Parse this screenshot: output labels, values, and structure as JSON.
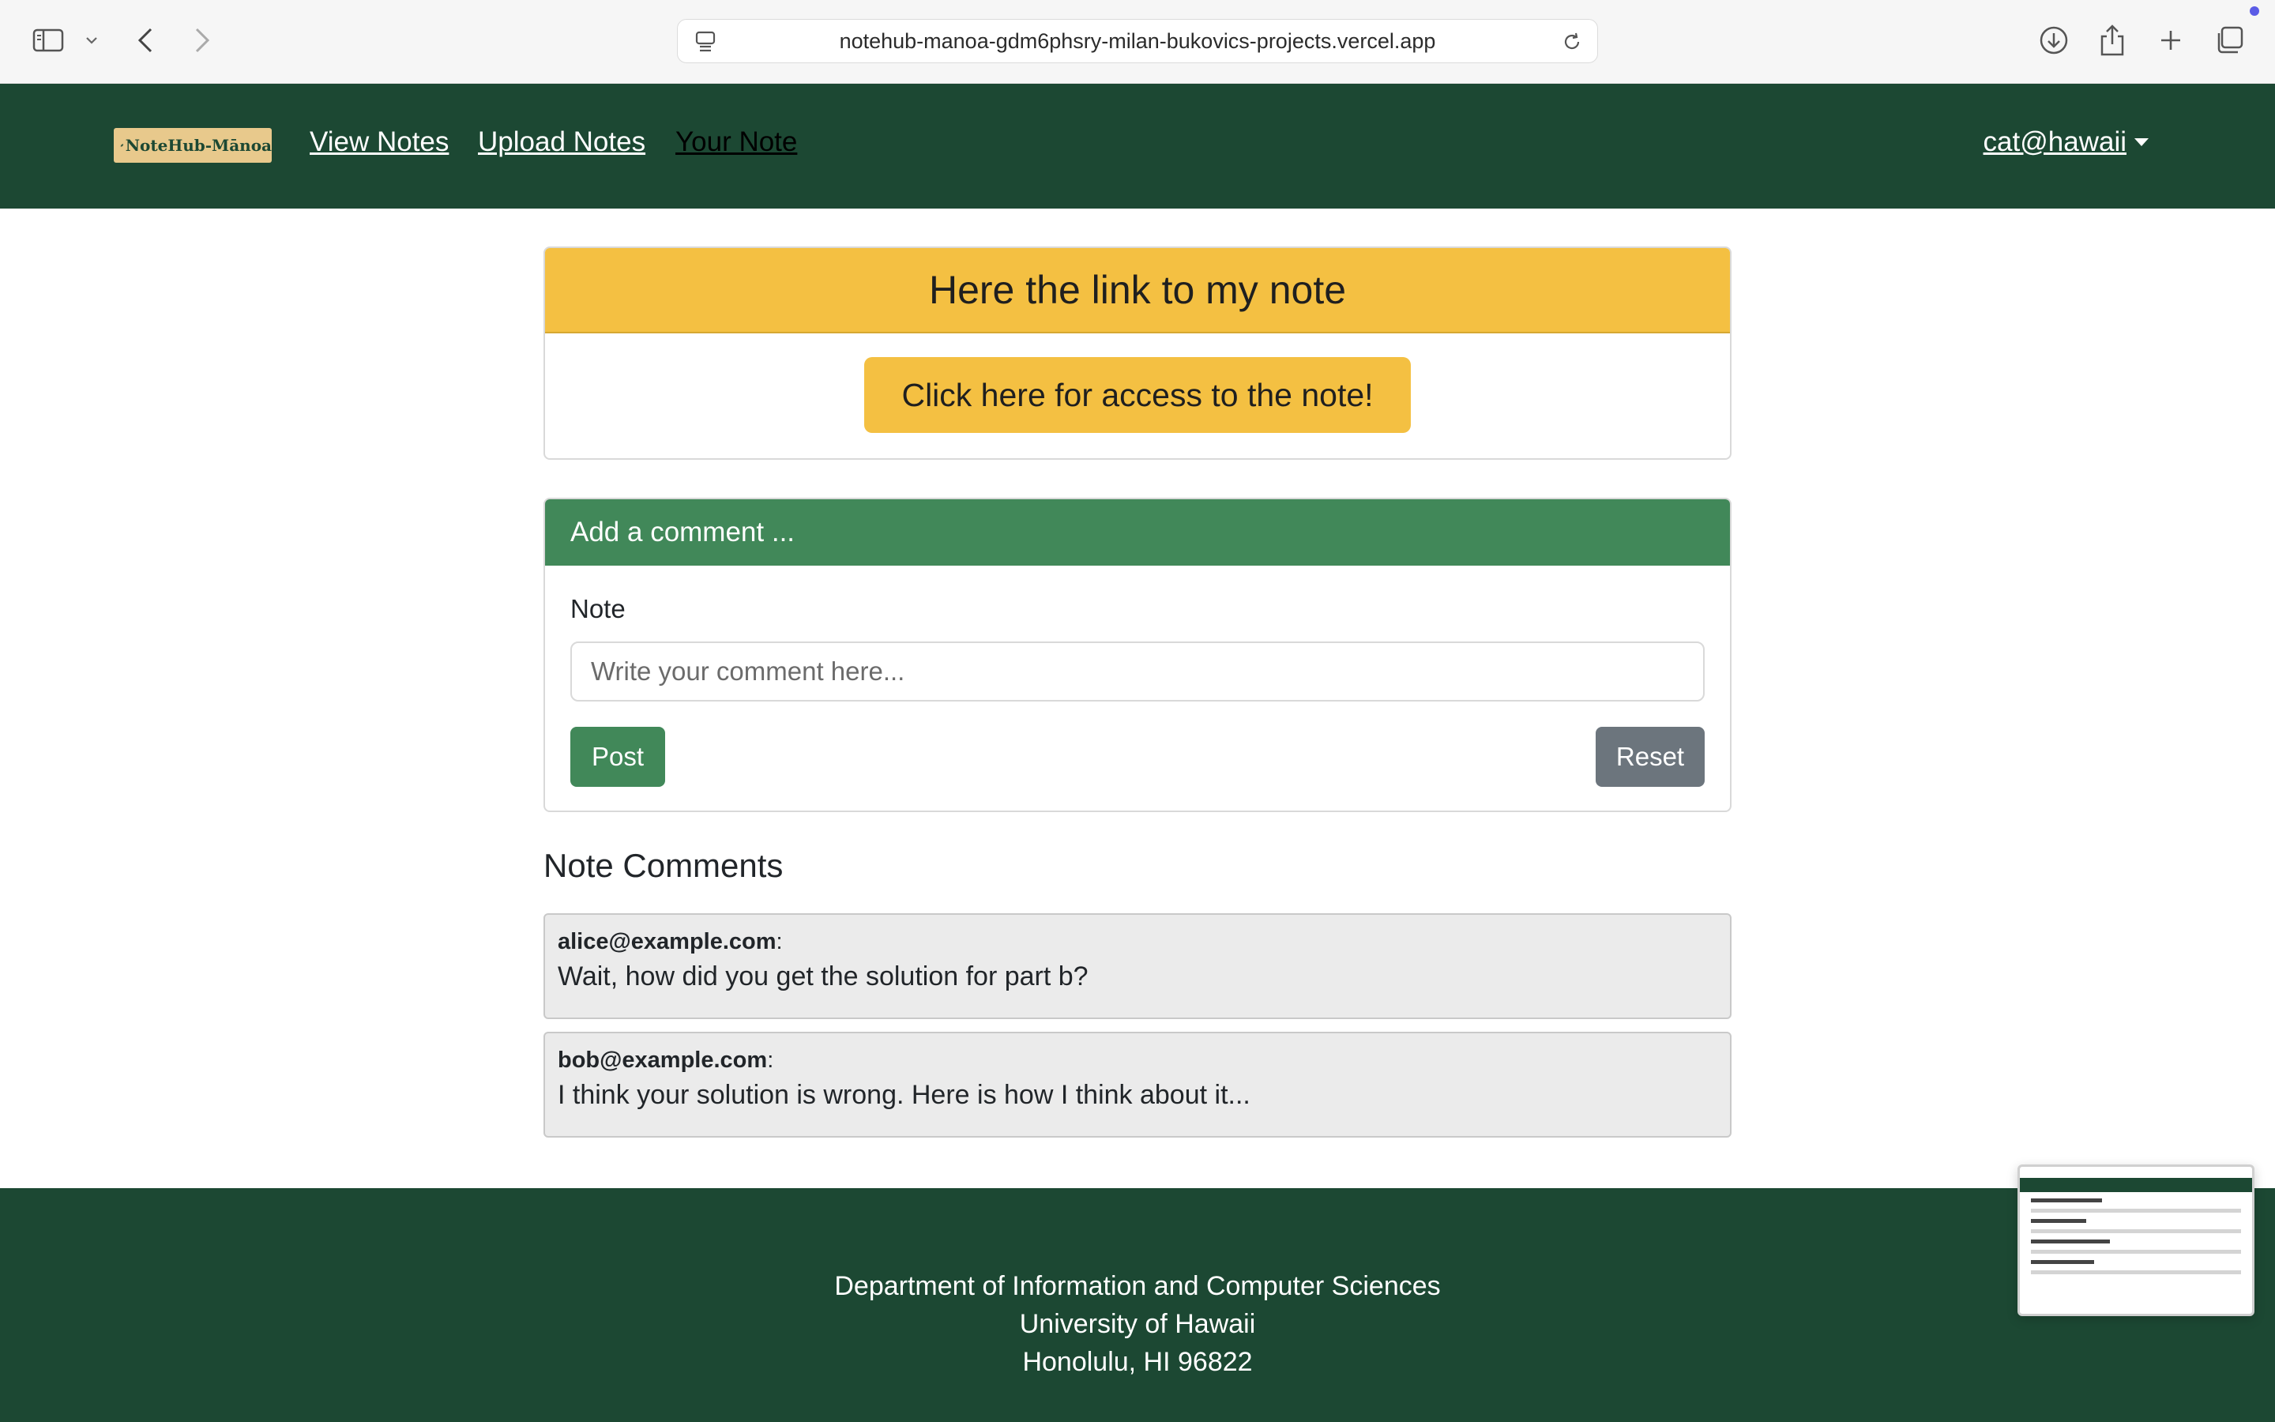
{
  "browser": {
    "url": "notehub-manoa-gdm6phsry-milan-bukovics-projects.vercel.app"
  },
  "navbar": {
    "brand": "NoteHub-Mānoa",
    "links": [
      "View Notes",
      "Upload Notes",
      "Your Note"
    ],
    "active_link": "Your Note",
    "user": "cat@hawaii"
  },
  "note_card": {
    "title": "Here the link to my note",
    "button_label": "Click here for access to the note!"
  },
  "comment_form": {
    "header": "Add a comment ...",
    "field_label": "Note",
    "placeholder": "Write your comment here...",
    "post_label": "Post",
    "reset_label": "Reset"
  },
  "comments": {
    "title": "Note Comments",
    "items": [
      {
        "author": "alice@example.com",
        "text": "Wait, how did you get the solution for part b?"
      },
      {
        "author": "bob@example.com",
        "text": "I think your solution is wrong. Here is how I think about it..."
      }
    ]
  },
  "footer": {
    "lines": [
      "Department of Information and Computer Sciences",
      "University of Hawaii",
      "Honolulu, HI 96822"
    ]
  },
  "colors": {
    "nav_green": "#1c4833",
    "accent_yellow": "#f4c042",
    "form_green": "#418859",
    "reset_gray": "#6c757d"
  }
}
